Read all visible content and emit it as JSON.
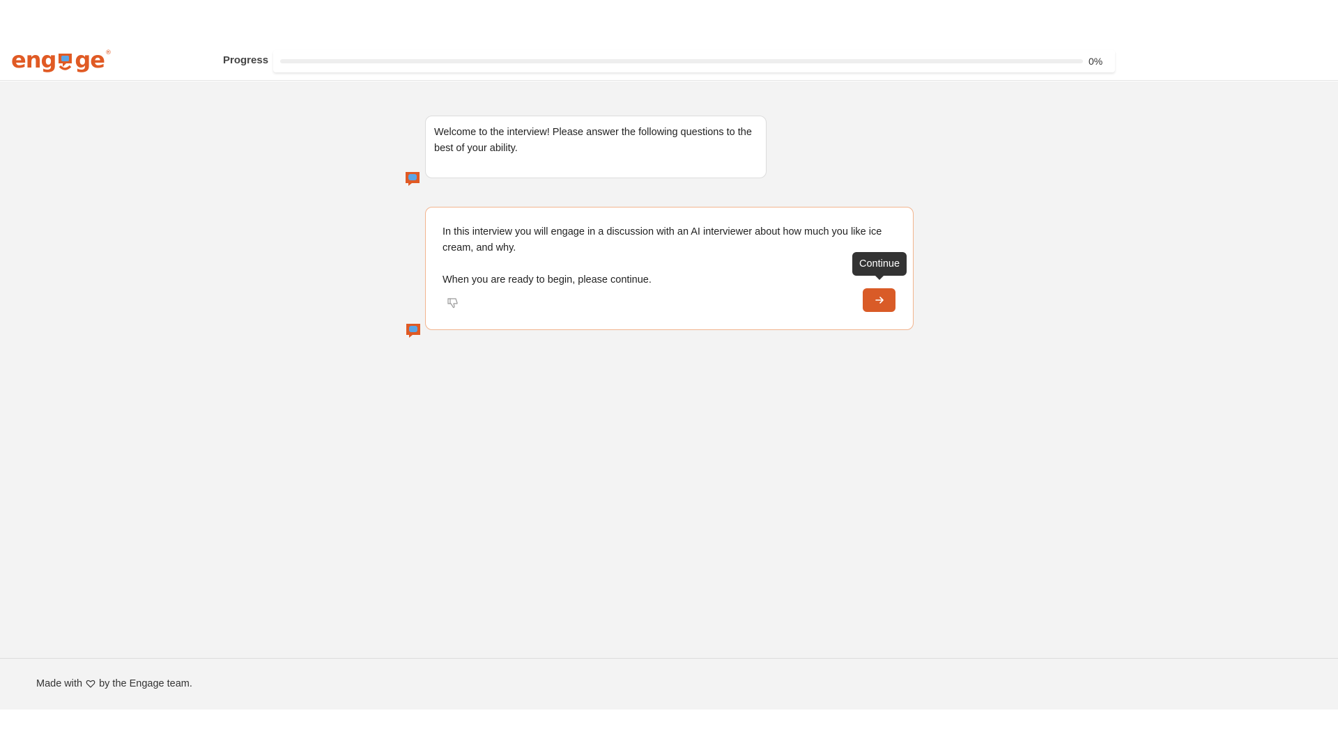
{
  "brand": {
    "name_left": "eng",
    "name_right": "ge",
    "trademark": "®",
    "color": "#e05a24"
  },
  "header": {
    "progress_label": "Progress",
    "progress_value": "0%",
    "progress_fraction": 0
  },
  "messages": [
    {
      "text": "Welcome to the interview! Please answer the following questions to the best of your ability."
    },
    {
      "paragraph_1": "In this interview you will engage in a discussion with an AI interviewer about how much you like ice cream, and why.",
      "paragraph_2": "When you are ready to begin, please continue."
    }
  ],
  "actions": {
    "continue_tooltip": "Continue",
    "continue_icon": "arrow-right-icon",
    "dislike_icon": "thumbs-down-icon"
  },
  "footer": {
    "text_before": "Made with",
    "icon": "heart-icon",
    "text_after": "by the Engage team."
  },
  "colors": {
    "accent": "#d95b27",
    "accent_border": "#f2b48e",
    "avatar_blue": "#5aa5e6",
    "background": "#f3f3f3"
  }
}
